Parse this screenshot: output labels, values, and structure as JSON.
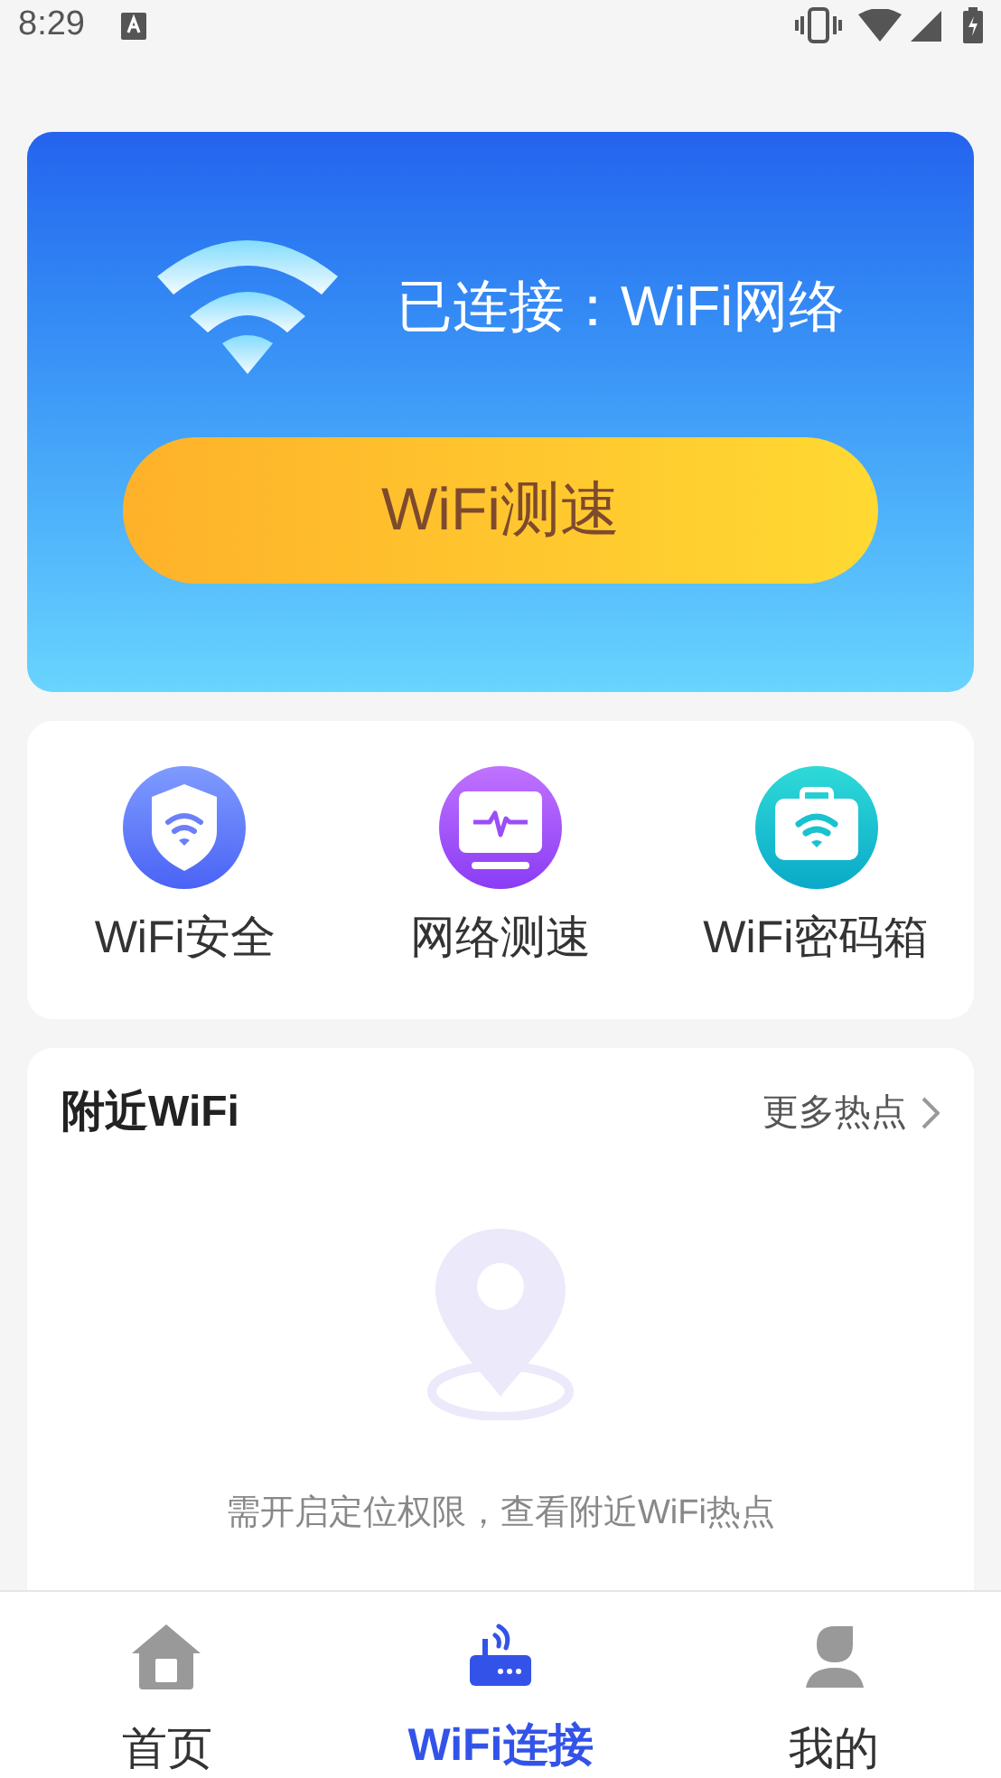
{
  "status_bar": {
    "time": "8:29"
  },
  "hero": {
    "connection": "已连接：WiFi网络",
    "button": "WiFi测速"
  },
  "features": [
    {
      "kind": "shield",
      "label": "WiFi安全"
    },
    {
      "kind": "monitor",
      "label": "网络测速"
    },
    {
      "kind": "case",
      "label": "WiFi密码箱"
    }
  ],
  "nearby": {
    "title": "附近WiFi",
    "more": "更多热点",
    "message": "需开启定位权限，查看附近WiFi热点"
  },
  "bottom_nav": [
    {
      "kind": "home",
      "label": "首页",
      "selected": false
    },
    {
      "kind": "router",
      "label": "WiFi连接",
      "selected": true
    },
    {
      "kind": "person",
      "label": "我的",
      "selected": false
    }
  ]
}
